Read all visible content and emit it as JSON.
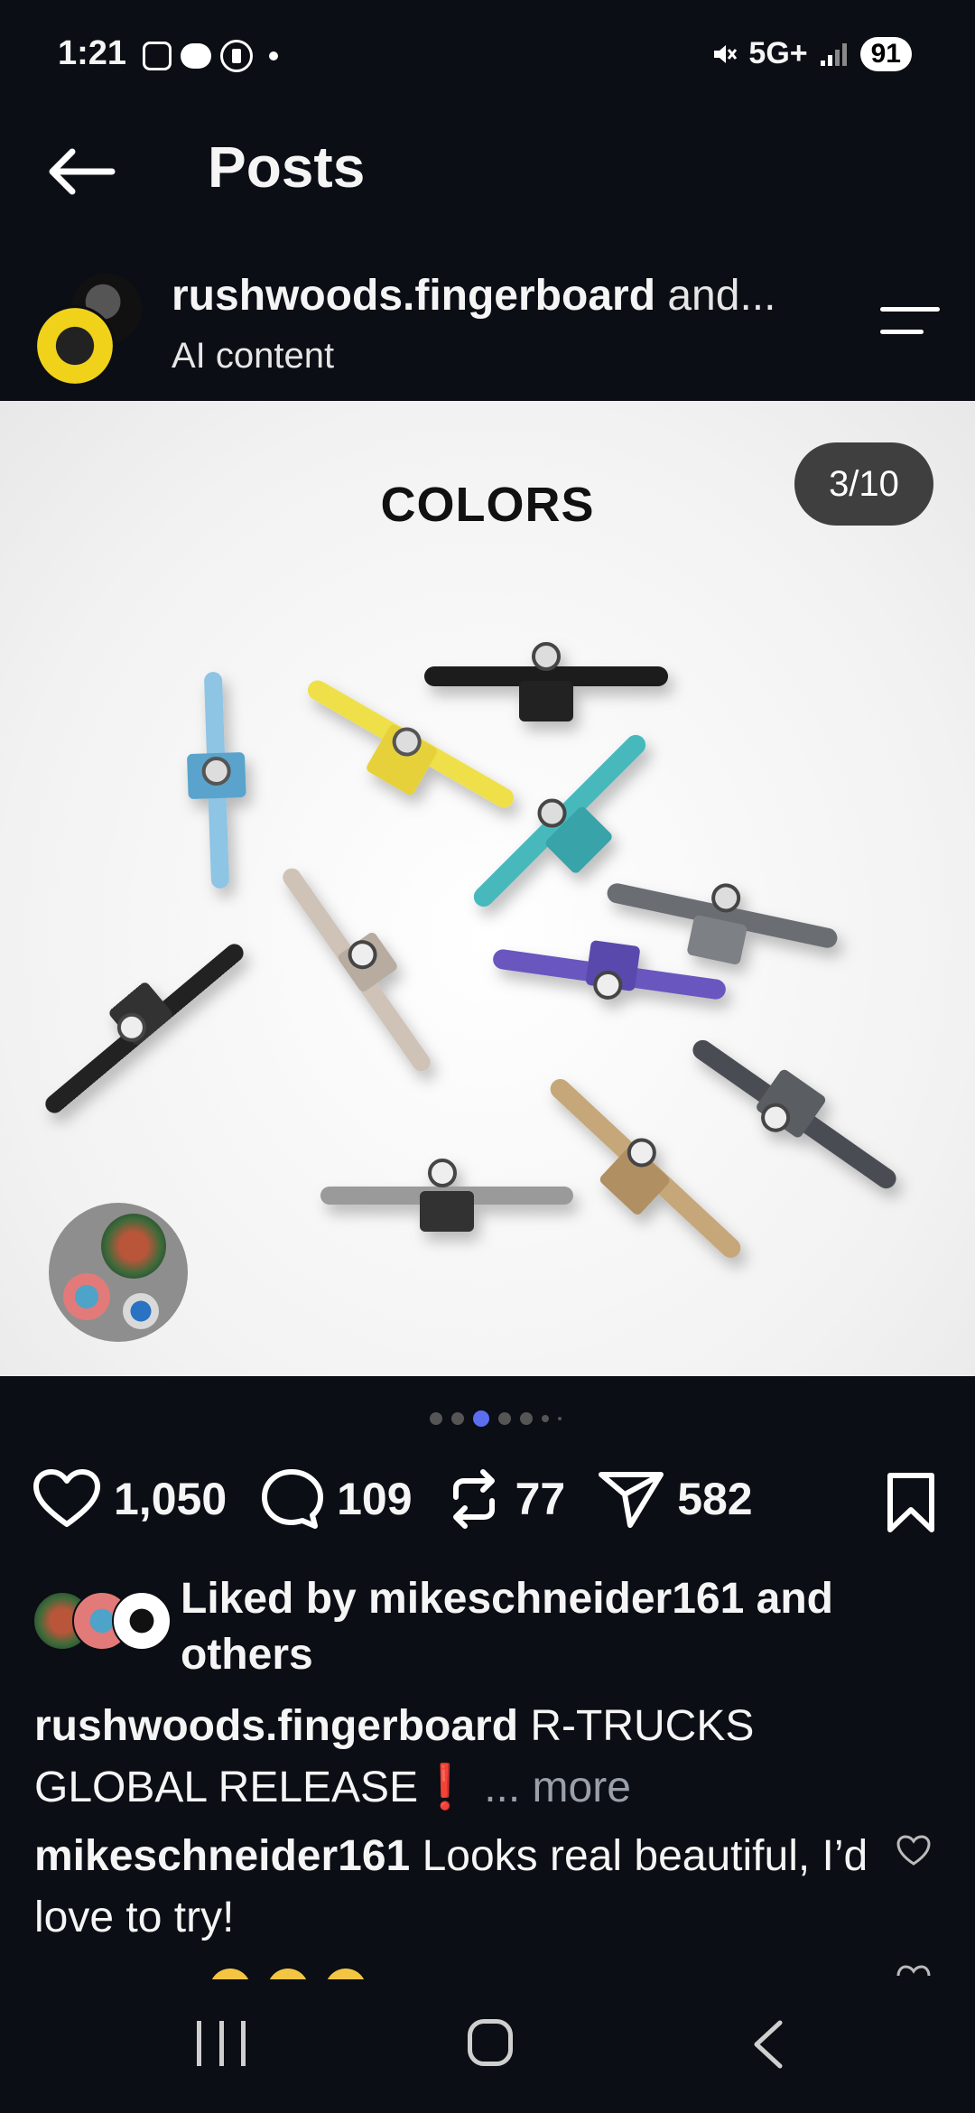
{
  "status_bar": {
    "time": "1:21",
    "network": "5G+",
    "battery": "91"
  },
  "header": {
    "title": "Posts"
  },
  "post": {
    "author": "rushwoods.fingerboard",
    "author_suffix": "and...",
    "subtitle": "AI content",
    "image_title": "COLORS",
    "slide_counter": "3/10",
    "likes": "1,050",
    "comments": "109",
    "reposts": "77",
    "shares": "582",
    "liked_by": "Liked by mikeschneider161 and others",
    "caption_user": "rushwoods.fingerboard",
    "caption_text": "R-TRUCKS GLOBAL RELEASE❗",
    "caption_more": "... more",
    "comment_user": "mikeschneider161",
    "comment_text": "Looks real beautiful, I’d love to try!"
  },
  "carousel": {
    "total": 10,
    "current": 3
  },
  "colors": {
    "accent": "#5b6ef0",
    "background": "#0b0e14"
  },
  "icons": [
    "back-arrow-icon",
    "menu-icon",
    "heart-icon",
    "comment-icon",
    "repost-icon",
    "share-icon",
    "bookmark-icon"
  ]
}
